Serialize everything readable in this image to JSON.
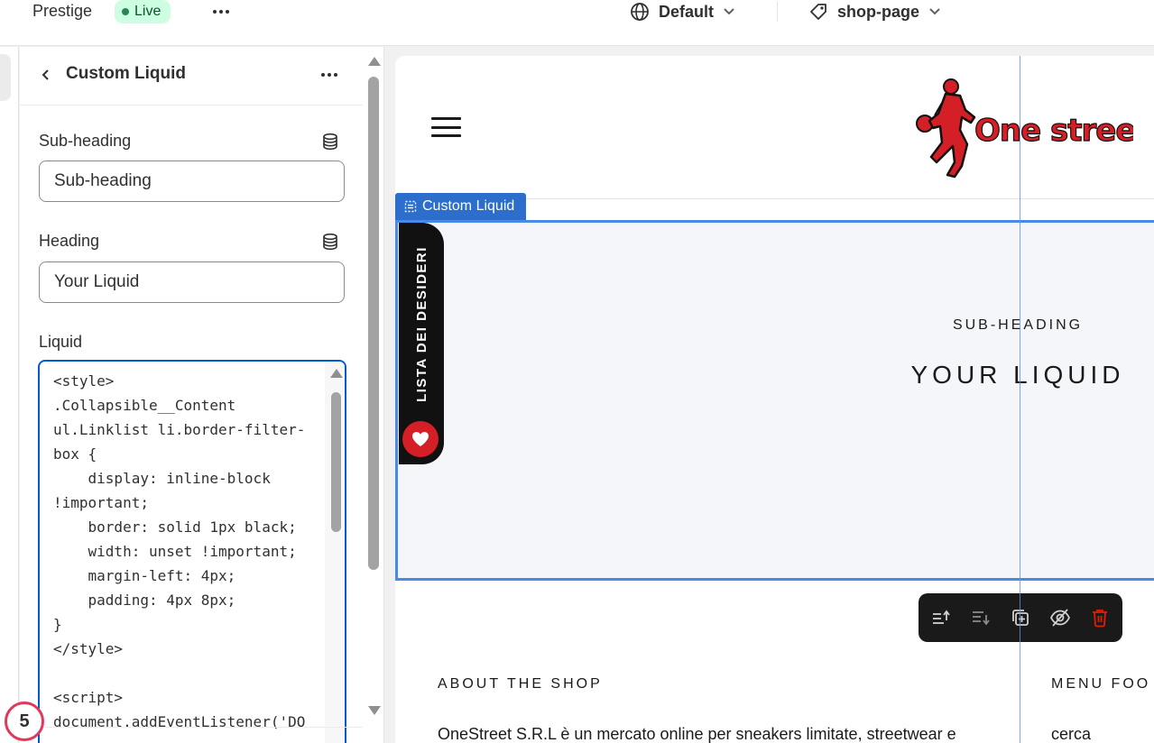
{
  "topbar": {
    "theme_name": "Prestige",
    "status_badge": "Live",
    "template_selector": "Default",
    "page_selector": "shop-page"
  },
  "panel": {
    "title": "Custom Liquid",
    "fields": {
      "subheading_label": "Sub-heading",
      "subheading_value": "Sub-heading",
      "heading_label": "Heading",
      "heading_value": "Your Liquid",
      "liquid_label": "Liquid",
      "liquid_code": "<style>\n.Collapsible__Content\nul.Linklist li.border-filter-\nbox {\n    display: inline-block\n!important;\n    border: solid 1px black;\n    width: unset !important;\n    margin-left: 4px;\n    padding: 4px 8px;\n}\n</style>\n\n<script>\ndocument.addEventListener('DO"
    },
    "step_badge": "5"
  },
  "preview": {
    "logo_text": "One street",
    "section_tag": "Custom Liquid",
    "wishlist_label": "LISTA DEI DESIDERI",
    "sub_heading": "SUB-HEADING",
    "heading": "YOUR LIQUID",
    "footer": {
      "about_title": "ABOUT THE SHOP",
      "menu_title": "MENU FOO",
      "about_text": "OneStreet S.R.L è un mercato online per sneakers limitate, streetwear e",
      "menu_link": "cerca"
    },
    "toolbar": [
      "move-up-icon",
      "move-down-icon",
      "duplicate-icon",
      "hide-icon",
      "delete-icon"
    ]
  },
  "colors": {
    "accent": "#005bd3",
    "section_outline": "#4a8ae6",
    "live_badge_bg": "#cdfee1",
    "brand_red": "#d41f26",
    "delete_red": "#e51c00"
  }
}
